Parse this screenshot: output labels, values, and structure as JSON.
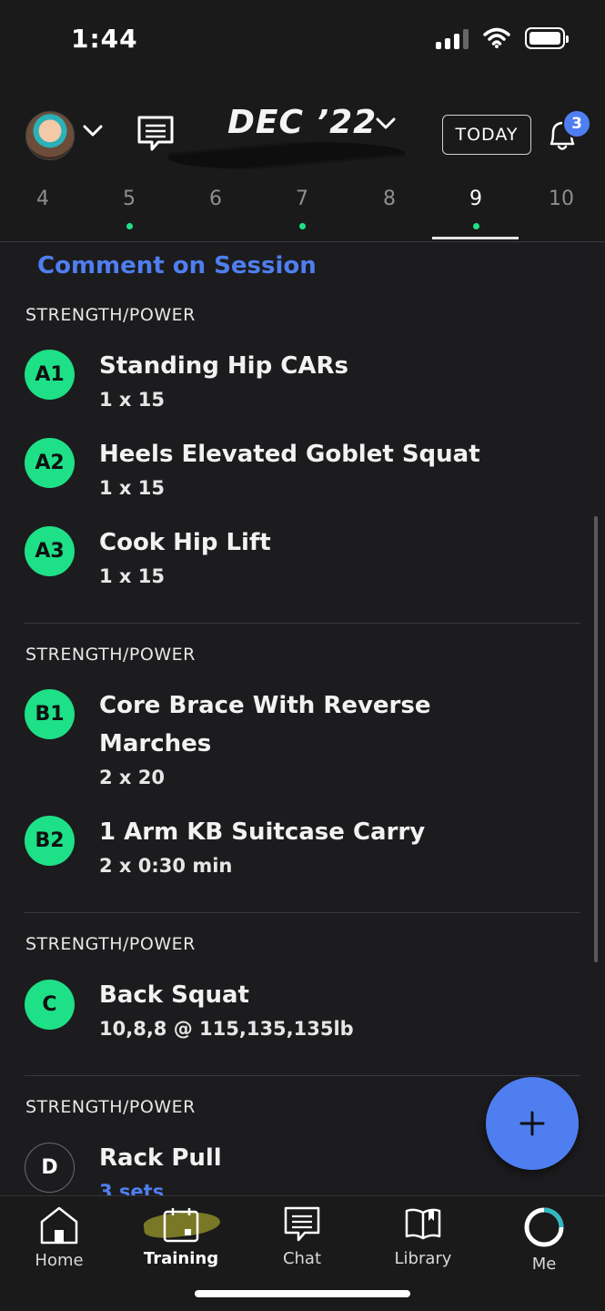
{
  "status_bar": {
    "time": "1:44"
  },
  "header": {
    "month_label": "DEC ’22",
    "today_label": "TODAY",
    "notification_count": "3",
    "days": [
      {
        "label": "4",
        "has_dot": false,
        "active": false
      },
      {
        "label": "5",
        "has_dot": true,
        "active": false
      },
      {
        "label": "6",
        "has_dot": false,
        "active": false
      },
      {
        "label": "7",
        "has_dot": true,
        "active": false
      },
      {
        "label": "8",
        "has_dot": false,
        "active": false
      },
      {
        "label": "9",
        "has_dot": true,
        "active": true
      },
      {
        "label": "10",
        "has_dot": false,
        "active": false
      }
    ]
  },
  "session": {
    "comment_link": "Comment on Session",
    "groups": [
      {
        "label": "STRENGTH/POWER",
        "exercises": [
          {
            "code": "A1",
            "name": "Standing Hip CARs",
            "sets": "1 x 15"
          },
          {
            "code": "A2",
            "name": "Heels Elevated Goblet Squat",
            "sets": "1 x 15"
          },
          {
            "code": "A3",
            "name": "Cook Hip Lift",
            "sets": "1 x 15"
          }
        ]
      },
      {
        "label": "STRENGTH/POWER",
        "exercises": [
          {
            "code": "B1",
            "name": "Core Brace With Reverse Marches",
            "sets": "2 x 20"
          },
          {
            "code": "B2",
            "name": "1 Arm KB Suitcase Carry",
            "sets": "2 x 0:30 min"
          }
        ]
      },
      {
        "label": "STRENGTH/POWER",
        "exercises": [
          {
            "code": "C",
            "name": "Back Squat",
            "sets": "10,8,8 @ 115,135,135lb"
          }
        ]
      },
      {
        "label": "STRENGTH/POWER",
        "exercises": [
          {
            "code": "D",
            "name": "Rack Pull",
            "sets": "3 sets"
          }
        ]
      }
    ]
  },
  "tabbar": {
    "items": [
      {
        "label": "Home",
        "icon": "home-icon"
      },
      {
        "label": "Training",
        "icon": "calendar-icon",
        "active": true
      },
      {
        "label": "Chat",
        "icon": "chat-icon"
      },
      {
        "label": "Library",
        "icon": "book-icon"
      },
      {
        "label": "Me",
        "icon": "profile-ring-icon"
      }
    ]
  },
  "colors": {
    "accent": "#4f7ef0",
    "green": "#1ee087",
    "background": "#1c1c1e"
  }
}
